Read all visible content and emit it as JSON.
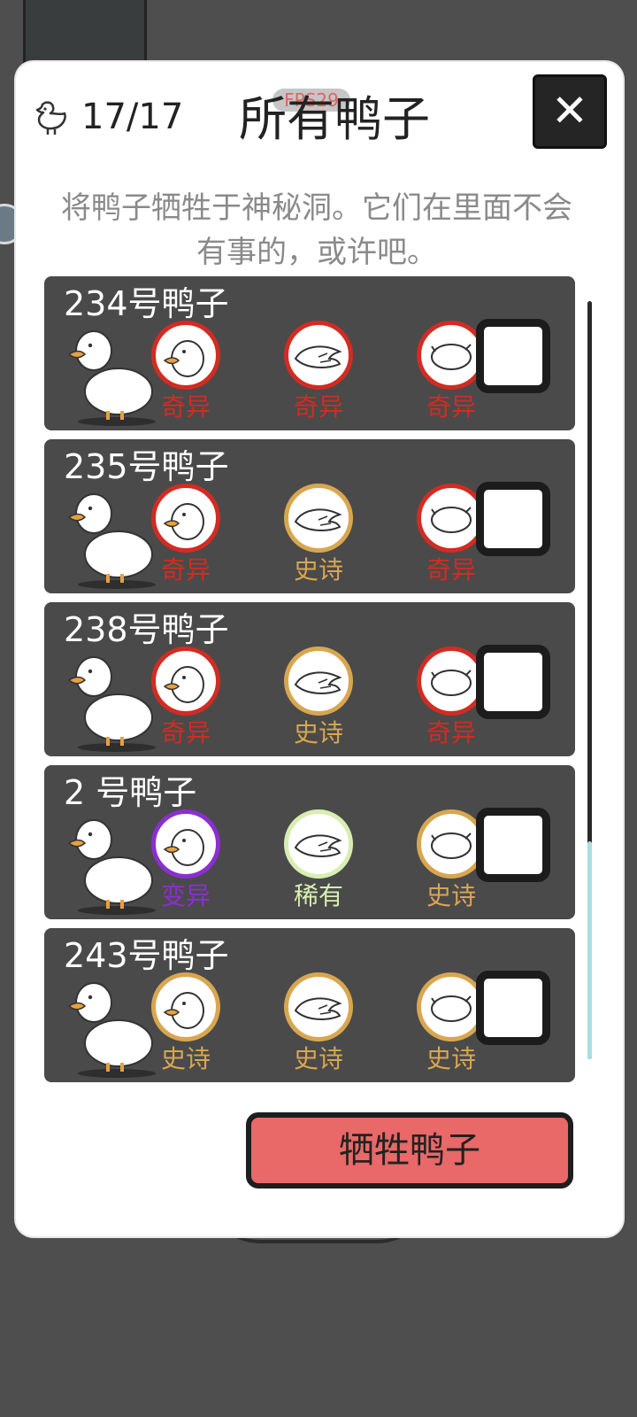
{
  "header": {
    "duck_count": "17/17",
    "fps": "FPS29",
    "title": "所有鸭子",
    "close_label": "✕"
  },
  "description": "将鸭子牺牲于神秘洞。它们在里面不会有事的，或许吧。",
  "colors": {
    "strange": "#d32b22",
    "epic": "#d9a650",
    "mutant": "#8a2fd1",
    "rare": "#d8eeb0"
  },
  "ducks": [
    {
      "name": "234号鸭子",
      "traits": [
        {
          "part": "head",
          "rarity": "奇异",
          "color": "#d32b22"
        },
        {
          "part": "wing",
          "rarity": "奇异",
          "color": "#d32b22"
        },
        {
          "part": "body",
          "rarity": "奇异",
          "color": "#d32b22"
        }
      ]
    },
    {
      "name": "235号鸭子",
      "traits": [
        {
          "part": "head",
          "rarity": "奇异",
          "color": "#d32b22"
        },
        {
          "part": "wing",
          "rarity": "史诗",
          "color": "#d9a650"
        },
        {
          "part": "body",
          "rarity": "奇异",
          "color": "#d32b22"
        }
      ]
    },
    {
      "name": "238号鸭子",
      "traits": [
        {
          "part": "head",
          "rarity": "奇异",
          "color": "#d32b22"
        },
        {
          "part": "wing",
          "rarity": "史诗",
          "color": "#d9a650"
        },
        {
          "part": "body",
          "rarity": "奇异",
          "color": "#d32b22"
        }
      ]
    },
    {
      "name": "2  号鸭子",
      "traits": [
        {
          "part": "head",
          "rarity": "变异",
          "color": "#8a2fd1"
        },
        {
          "part": "wing",
          "rarity": "稀有",
          "color": "#d8eeb0"
        },
        {
          "part": "body",
          "rarity": "史诗",
          "color": "#d9a650"
        }
      ]
    },
    {
      "name": "243号鸭子",
      "traits": [
        {
          "part": "head",
          "rarity": "史诗",
          "color": "#d9a650"
        },
        {
          "part": "wing",
          "rarity": "史诗",
          "color": "#d9a650"
        },
        {
          "part": "body",
          "rarity": "史诗",
          "color": "#d9a650"
        }
      ]
    }
  ],
  "sacrifice_button": "牺牲鸭子"
}
